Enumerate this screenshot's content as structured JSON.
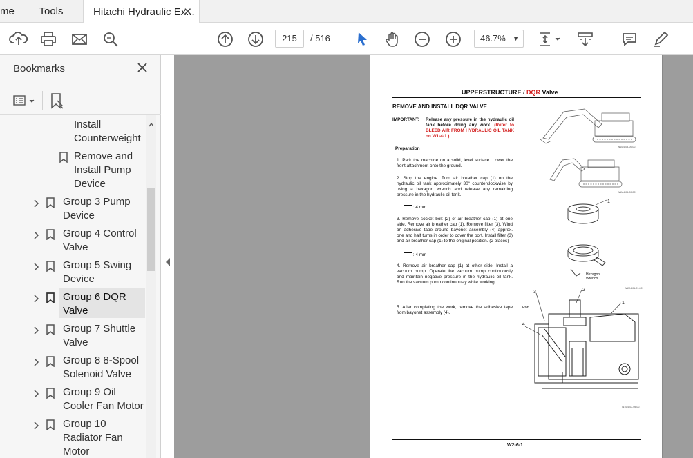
{
  "tabs": {
    "home": "me",
    "tools": "Tools",
    "document": "Hitachi Hydraulic Ex..."
  },
  "toolbar": {
    "page_current": "215",
    "page_total": "/ 516",
    "zoom": "46.7%",
    "icons": [
      "cloud-upload-icon",
      "print-icon",
      "mail-icon",
      "search-icon",
      "prev-page-icon",
      "next-page-icon",
      "select-cursor-icon",
      "hand-tool-icon",
      "zoom-out-icon",
      "zoom-in-icon",
      "fit-page-icon",
      "scroll-mode-icon",
      "comment-icon",
      "sign-pen-icon"
    ]
  },
  "sidebar": {
    "title": "Bookmarks",
    "items": [
      {
        "label_lines": [
          "Install",
          "Counterweight"
        ]
      },
      {
        "label_lines": [
          "Remove and",
          "Install Pump",
          "Device"
        ]
      },
      {
        "label_lines": [
          "Group 3 Pump",
          "Device"
        ]
      },
      {
        "label_lines": [
          "Group 4 Control",
          "Valve"
        ]
      },
      {
        "label_lines": [
          "Group 5 Swing",
          "Device"
        ]
      },
      {
        "label_lines": [
          "Group 6 DQR",
          "Valve"
        ]
      },
      {
        "label_lines": [
          "Group 7 Shuttle",
          "Valve"
        ]
      },
      {
        "label_lines": [
          "Group 8 8-Spool",
          "Solenoid Valve"
        ]
      },
      {
        "label_lines": [
          "Group 9 Oil",
          "Cooler Fan Motor"
        ]
      },
      {
        "label_lines": [
          "Group 10",
          "Radiator Fan",
          "Motor"
        ]
      }
    ]
  },
  "document": {
    "header_a": "UPPERSTRUCTURE / ",
    "header_b": "DQR",
    "header_c": " Valve",
    "section": "REMOVE AND INSTALL DQR VALVE",
    "important_label": "IMPORTANT:",
    "important_text": "Release any pressure in the hydraulic oil tank before doing any work.",
    "important_ref": "(Refer to BLEED AIR FROM HYDRAULIC OIL TANK on W1-4-1.)",
    "prep_title": "Preparation",
    "steps": [
      "1. Park the machine on a solid, level surface. Lower the front attachment onto the ground.",
      "2. Stop the engine. Turn air breather cap (1) on the hydraulic oil tank approximately 30° counterclockwise by using a hexagon wrench and release any remaining pressure in the hydraulic oil tank.",
      "3. Remove socket bolt (2) of air breather cap (1) at one side. Remove air breather cap (1). Remove filter (3). Wind an adhesive tape around bayonet assembly (4) approx. one and half turns in order to cover the port. Install filter (3) and air breather cap (1) to the original position. (2 places)",
      "4. Remove air breather cap (1) at other side. Install a vacuum pump. Operate the vacuum pump continuously and maintain negative pressure in the hydraulic oil tank. Run the vacuum pump continuously while working.",
      "5. After completing the work, remove the adhesive tape from bayonet assembly (4)."
    ],
    "wrench_note_1": ": 4 mm",
    "wrench_note_2": ": 4 mm",
    "fig_labels": {
      "n1": "1",
      "n2": "2",
      "n3": "3",
      "n4": "4",
      "port": "Port",
      "hex": "Hexagon",
      "wrench": "Wrench"
    },
    "fig_codes": [
      "W1M4-03-00-001",
      "W1M4-05-00-001",
      "W1M4-01-01-001",
      "W1M4-02-05-001"
    ],
    "footer": "W2-6-1"
  }
}
